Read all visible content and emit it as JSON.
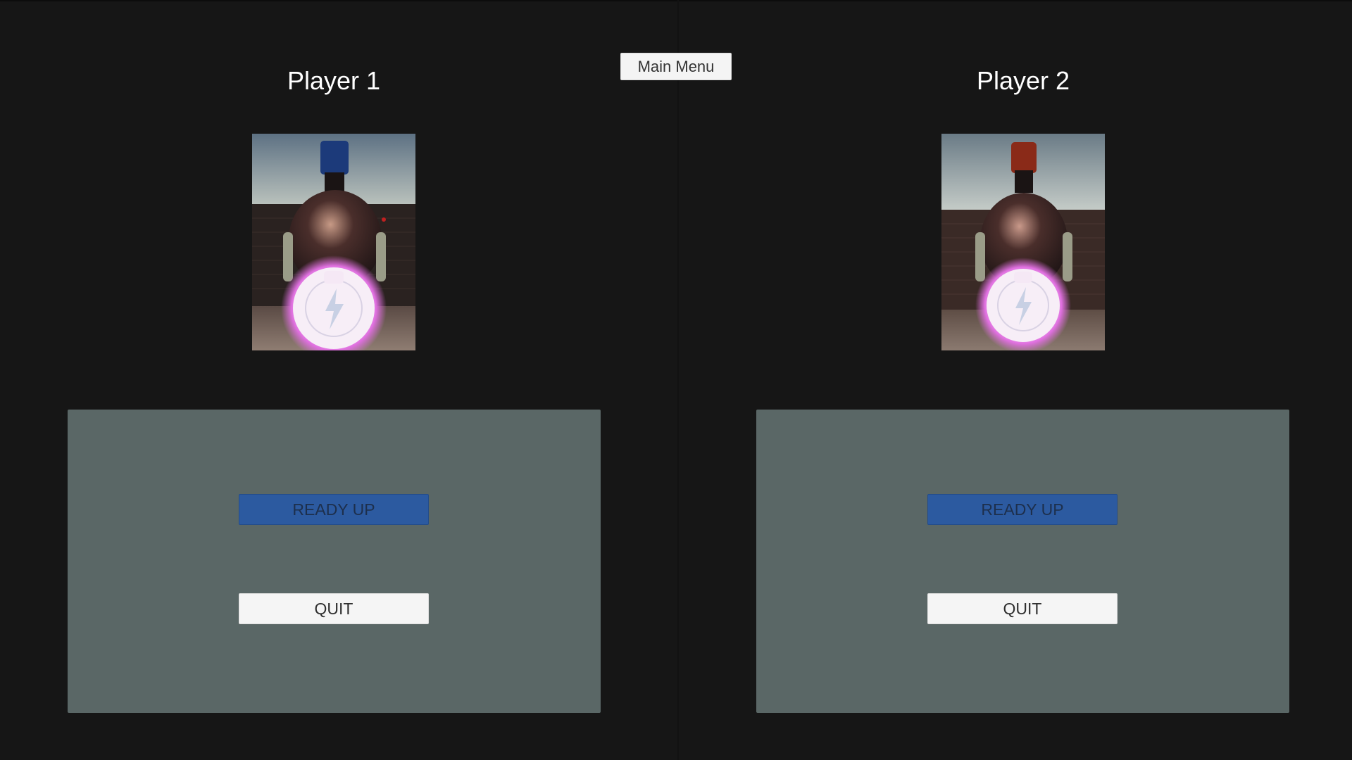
{
  "header": {
    "main_menu_label": "Main Menu"
  },
  "players": [
    {
      "title": "Player 1",
      "plume_color": "#1c3a7a",
      "ready_label": "READY UP",
      "quit_label": "QUIT"
    },
    {
      "title": "Player 2",
      "plume_color": "#8a2a18",
      "ready_label": "READY UP",
      "quit_label": "QUIT"
    }
  ],
  "colors": {
    "background": "#161616",
    "panel": "#5a6766",
    "ready_button": "#2c5aa0",
    "quit_button": "#f5f5f5",
    "orb_glow": "#e070e0"
  }
}
